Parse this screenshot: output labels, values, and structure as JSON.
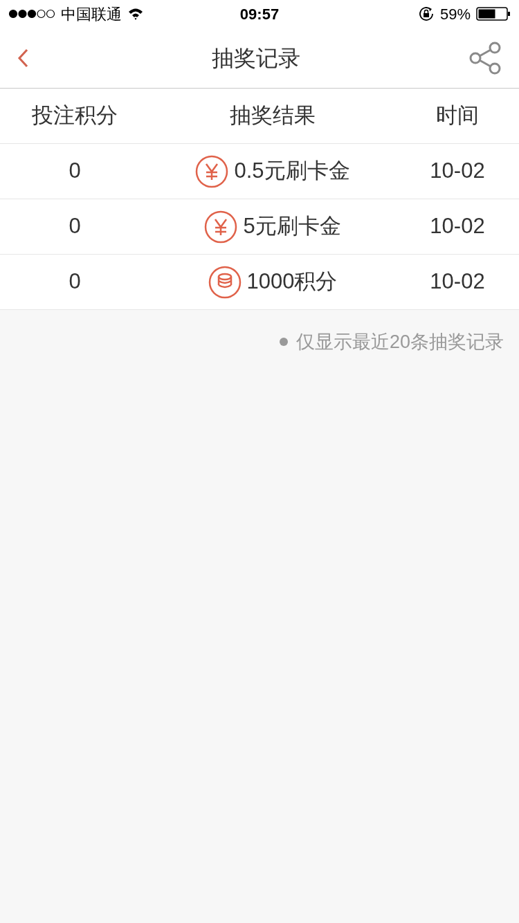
{
  "status_bar": {
    "carrier": "中国联通",
    "time": "09:57",
    "battery": "59%"
  },
  "nav": {
    "title": "抽奖记录"
  },
  "table": {
    "columns": [
      "投注积分",
      "抽奖结果",
      "时间"
    ],
    "rows": [
      {
        "stake": "0",
        "result": "0.5元刷卡金",
        "kind": "cash",
        "time": "10-02"
      },
      {
        "stake": "0",
        "result": "5元刷卡金",
        "kind": "cash",
        "time": "10-02"
      },
      {
        "stake": "0",
        "result": "1000积分",
        "kind": "points",
        "time": "10-02"
      }
    ]
  },
  "note": "仅显示最近20条抽奖记录"
}
